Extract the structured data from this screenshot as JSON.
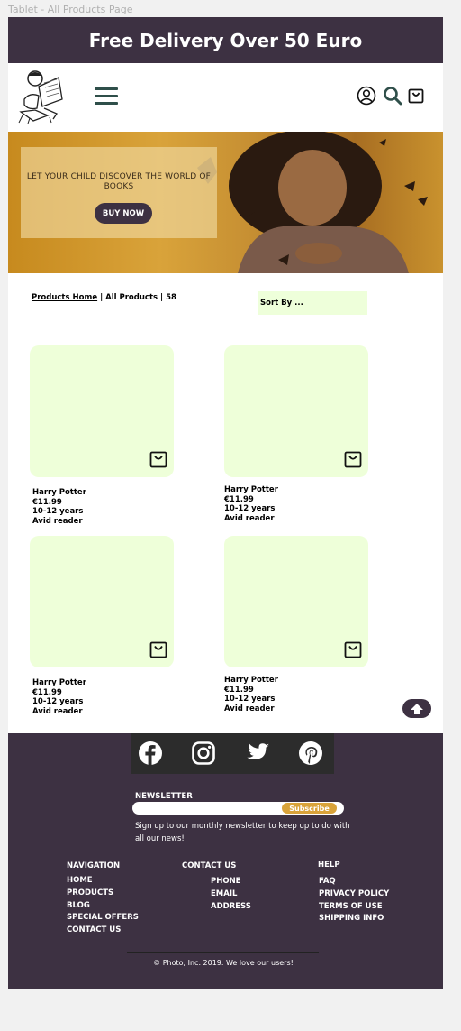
{
  "frame_label": "Tablet - All Products Page",
  "promo": {
    "text": "Free Delivery Over 50 Euro"
  },
  "hero": {
    "headline": "LET YOUR CHILD DISCOVER THE WORLD OF BOOKS",
    "cta": "BUY NOW"
  },
  "breadcrumb": {
    "home": "Products Home",
    "current": "All Products",
    "count": "58",
    "separator": "|"
  },
  "sort": {
    "label": "Sort By ..."
  },
  "products": [
    {
      "title": "Harry Potter",
      "price": "€11.99",
      "age": "10-12 years",
      "level": "Avid reader"
    },
    {
      "title": "Harry Potter",
      "price": "€11.99",
      "age": "10-12 years",
      "level": "Avid reader"
    },
    {
      "title": "Harry Potter",
      "price": "€11.99",
      "age": "10-12 years",
      "level": "Avid reader"
    },
    {
      "title": "Harry Potter",
      "price": "€11.99",
      "age": "10-12 years",
      "level": "Avid reader"
    }
  ],
  "footer": {
    "newsletter": {
      "title": "NEWSLETTER",
      "button": "Subscribe",
      "description": "Sign up to our monthly newsletter to keep up to do with all our news!"
    },
    "navigation": {
      "title": "NAVIGATION",
      "items": [
        "HOME",
        "PRODUCTS",
        "BLOG",
        "SPECIAL OFFERS",
        "CONTACT US"
      ]
    },
    "contact": {
      "title": "CONTACT US",
      "items": [
        "PHONE",
        "EMAIL",
        "ADDRESS"
      ]
    },
    "help": {
      "title": "HELP",
      "items": [
        "FAQ",
        "PRIVACY POLICY",
        "TERMS OF USE",
        "SHIPPING INFO"
      ]
    },
    "copyright": "© Photo, Inc. 2019. We love our users!"
  },
  "colors": {
    "brand": "#3d3142",
    "card": "#eeffd9",
    "accent": "#d9a33a",
    "icon": "#2f4f4a"
  },
  "icons": [
    "menu-icon",
    "user-icon",
    "search-icon",
    "bag-icon",
    "arrow-up-icon",
    "facebook-icon",
    "instagram-icon",
    "twitter-icon",
    "pinterest-icon"
  ]
}
